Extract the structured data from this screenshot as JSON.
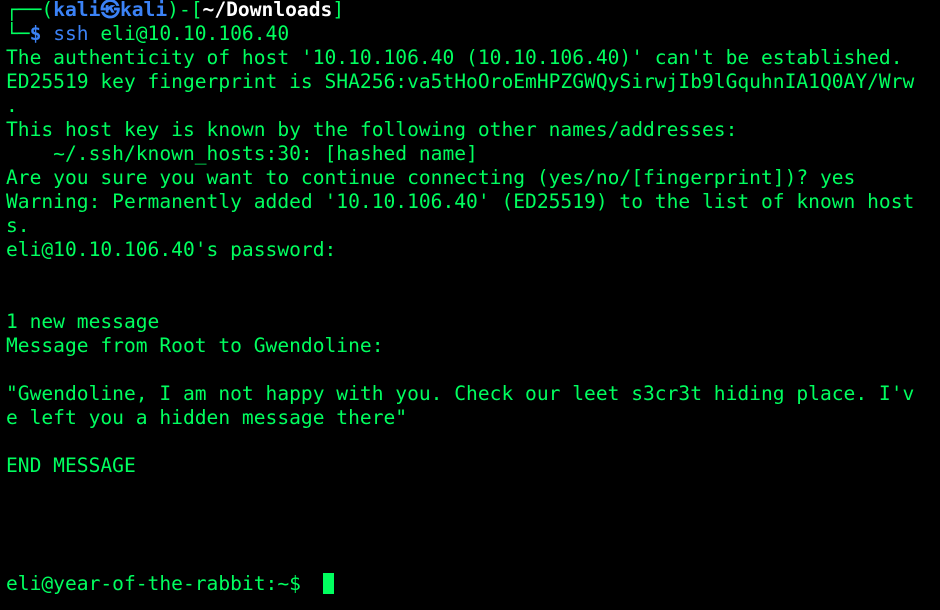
{
  "prompt": {
    "open_bracket": "┌──(",
    "user": "kali",
    "at_symbol": "㉿",
    "host": "kali",
    "mid": ")-[",
    "directory": "~/Downloads",
    "close_bracket": "]",
    "line2_prefix": "└─",
    "dollar": "$",
    "command": "ssh",
    "command_args": "eli@10.10.106.40"
  },
  "output_lines": [
    "The authenticity of host '10.10.106.40 (10.10.106.40)' can't be established.",
    "ED25519 key fingerprint is SHA256:va5tHoOroEmHPZGWQySirwjIb9lGquhnIA1Q0AY/Wrw",
    ".",
    "This host key is known by the following other names/addresses:",
    "    ~/.ssh/known_hosts:30: [hashed name]",
    "Are you sure you want to continue connecting (yes/no/[fingerprint])? yes",
    "Warning: Permanently added '10.10.106.40' (ED25519) to the list of known host",
    "s.",
    "eli@10.10.106.40's password: ",
    "",
    "",
    "1 new message",
    "Message from Root to Gwendoline:",
    "",
    "\"Gwendoline, I am not happy with you. Check our leet s3cr3t hiding place. I'v",
    "e left you a hidden message there\"",
    "",
    "END MESSAGE"
  ],
  "remote_prompt": "eli@year-of-the-rabbit:~$ "
}
